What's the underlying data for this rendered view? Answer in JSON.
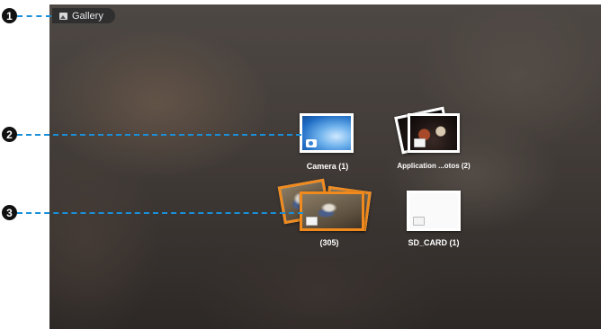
{
  "header": {
    "title": "Gallery",
    "icon": "gallery-icon"
  },
  "callouts": [
    "1",
    "2",
    "3"
  ],
  "albums": [
    {
      "caption": "Camera  (1)",
      "icon": "camera-icon"
    },
    {
      "caption": "Application ...otos  (2)",
      "icon": "folder-icon"
    },
    {
      "caption": "(305)",
      "icon": "folder-icon"
    },
    {
      "caption": "SD_CARD  (1)",
      "icon": "folder-icon"
    }
  ],
  "colors": {
    "accent": "#1a8fd8",
    "selected_border": "#f08a1c"
  }
}
